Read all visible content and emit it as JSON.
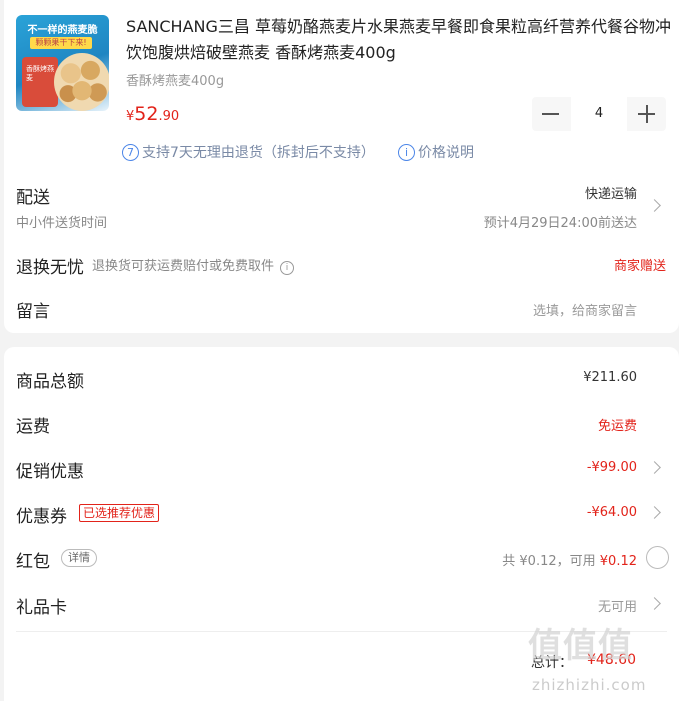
{
  "product": {
    "image": {
      "badge_text": "不一样的燕麦脆",
      "tag_text": "颗颗果干下来!",
      "pack_text": "香酥烤燕麦"
    },
    "title": "SANCHANG三昌 草莓奶酪燕麦片水果燕麦早餐即食果粒高纤营养代餐谷物冲饮饱腹烘焙破壁燕麦 香酥烤燕麦400g",
    "spec": "香酥烤燕麦400g",
    "price": {
      "currency": "¥",
      "integer": "52",
      "decimal": ".90"
    },
    "quantity": "4",
    "service_badge": "7",
    "service_text": "支持7天无理由退货（拆封后不支持）",
    "price_info_icon": "i",
    "price_info_text": "价格说明"
  },
  "delivery": {
    "label": "配送",
    "sub": "中小件送货时间",
    "method": "快递运输",
    "eta": "预计4月29日24:00前送达"
  },
  "returns": {
    "label": "退换无忧",
    "desc": "退换货可获运费赔付或免费取件",
    "info_icon": "i",
    "right": "商家赠送"
  },
  "message": {
    "label": "留言",
    "placeholder": "选填，给商家留言"
  },
  "summary": {
    "goods_total_label": "商品总额",
    "goods_total_value": "¥211.60",
    "shipping_label": "运费",
    "shipping_value": "免运费",
    "promo_label": "促销优惠",
    "promo_value": "-¥99.00",
    "coupon_label": "优惠券",
    "coupon_badge": "已选推荐优惠",
    "coupon_value": "-¥64.00",
    "redpacket_label": "红包",
    "redpacket_pill": "详情",
    "redpacket_total": "共 ¥0.12，可用",
    "redpacket_available": "¥0.12",
    "giftcard_label": "礼品卡",
    "giftcard_value": "无可用",
    "total_label": "总计：",
    "total_value": "¥48.60"
  },
  "watermark": {
    "main": "值值值",
    "sub": "zhizhizhi.com"
  },
  "colors": {
    "accent_red": "#e2231a",
    "info_blue": "#4c86e8",
    "background": "#f3f3f3"
  }
}
